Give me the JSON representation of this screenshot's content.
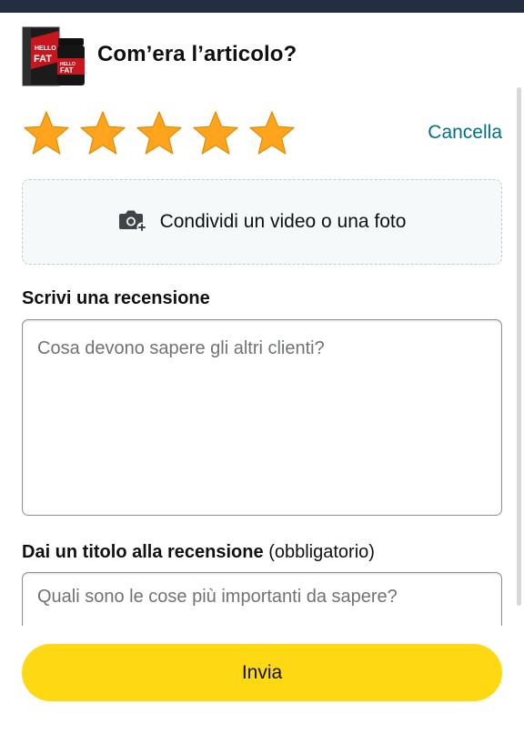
{
  "product": {
    "image_text_1": "HELLO",
    "image_text_2": "FAT",
    "colors": {
      "box": "#1a1a1a",
      "accent": "#d32027"
    }
  },
  "header": {
    "title": "Com’era l’articolo?"
  },
  "rating": {
    "stars_selected": 5,
    "stars_total": 5,
    "star_color": "#ffa41c",
    "clear_label": "Cancella"
  },
  "media": {
    "label": "Condividi un video o una foto",
    "icon": "camera-plus-icon"
  },
  "review": {
    "label": "Scrivi una recensione",
    "placeholder": "Cosa devono sapere gli altri clienti?",
    "value": ""
  },
  "review_title": {
    "label": "Dai un titolo alla recensione",
    "required_note": "(obbligatorio)",
    "placeholder": "Quali sono le cose più importanti da sapere?",
    "value": ""
  },
  "submit": {
    "label": "Invia",
    "color": "#ffd814"
  },
  "colors": {
    "link": "#007185",
    "topbar": "#232f3e"
  }
}
